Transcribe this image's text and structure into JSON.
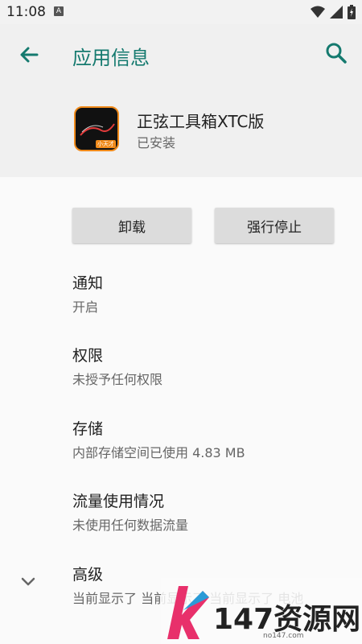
{
  "status_bar": {
    "time": "11:08",
    "notification_letter": "A"
  },
  "header": {
    "title": "应用信息"
  },
  "app": {
    "name": "正弦工具箱XTC版",
    "status": "已安装",
    "icon_badge": "小天才"
  },
  "buttons": {
    "uninstall": "卸载",
    "force_stop": "强行停止"
  },
  "items": [
    {
      "title": "通知",
      "subtitle": "开启"
    },
    {
      "title": "权限",
      "subtitle": "未授予任何权限"
    },
    {
      "title": "存储",
      "subtitle": "内部存储空间已使用 4.83 MB"
    },
    {
      "title": "流量使用情况",
      "subtitle": "未使用任何数据流量"
    },
    {
      "title": "高级",
      "subtitle": "当前显示了 当前显示了 当前显示了 电池"
    }
  ],
  "watermark": {
    "text": "147资源网",
    "url": "no147.com"
  },
  "colors": {
    "accent": "#157a6f",
    "icon_border": "#f08a1a"
  },
  "icons": [
    "back-arrow-icon",
    "search-icon",
    "wifi-icon",
    "signal-icon",
    "battery-icon",
    "chevron-down-icon"
  ]
}
